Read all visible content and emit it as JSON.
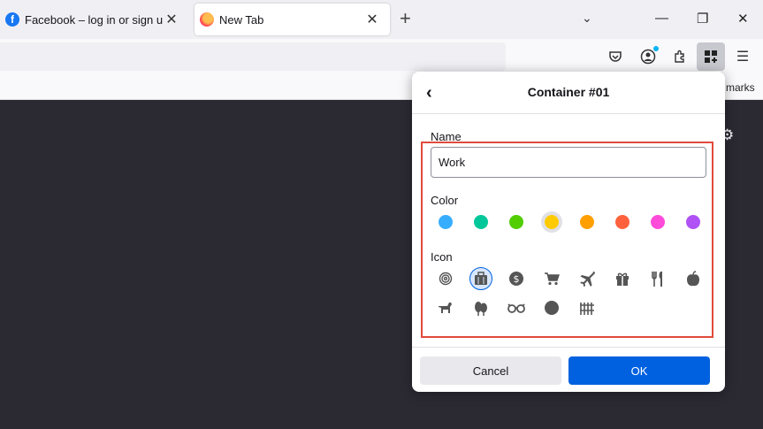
{
  "tabs": [
    {
      "title": "Facebook – log in or sign up",
      "favicon": "facebook-icon"
    },
    {
      "title": "New Tab",
      "favicon": "firefox-icon"
    }
  ],
  "toolbar": {
    "new_tab": "+",
    "bookmarks_text": "marks"
  },
  "panel": {
    "title": "Container #01",
    "back_icon": "‹",
    "name_label": "Name",
    "name_value": "Work",
    "color_label": "Color",
    "icon_label": "Icon",
    "colors": [
      "#37adff",
      "#00c79a",
      "#51cd00",
      "#ffcb00",
      "#ff9f00",
      "#ff613d",
      "#ff4bda",
      "#af51f5"
    ],
    "selected_color_index": 3,
    "icons": [
      "fingerprint-icon",
      "briefcase-icon",
      "dollar-icon",
      "cart-icon",
      "vacation-icon",
      "gift-icon",
      "food-icon",
      "fruit-icon",
      "pet-icon",
      "tree-icon",
      "chill-icon",
      "circle-icon",
      "fence-icon"
    ],
    "selected_icon_index": 1,
    "cancel_label": "Cancel",
    "ok_label": "OK"
  }
}
